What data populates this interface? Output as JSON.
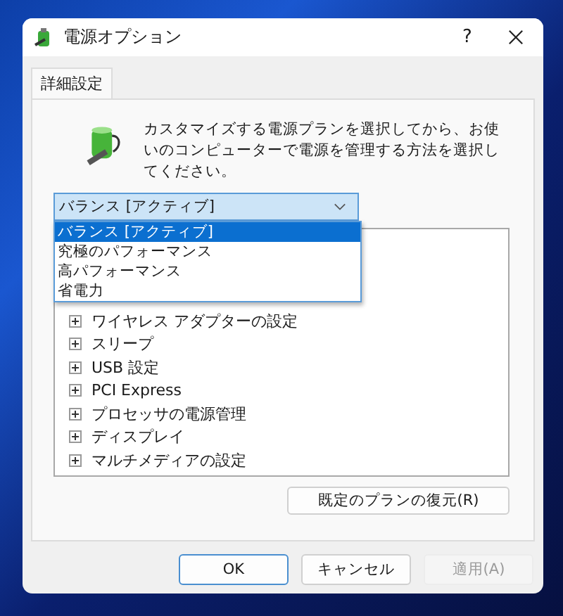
{
  "window": {
    "title": "電源オプション",
    "help": "?"
  },
  "tabs": [
    {
      "label": "詳細設定",
      "selected": true
    }
  ],
  "description": "カスタマイズする電源プランを選択してから、お使いのコンピューターで電源を管理する方法を選択してください。",
  "plan_select": {
    "value": "バランス [アクティブ]",
    "options": [
      {
        "label": "バランス [アクティブ]",
        "selected": true
      },
      {
        "label": "究極のパフォーマンス",
        "selected": false
      },
      {
        "label": "高パフォーマンス",
        "selected": false
      },
      {
        "label": "省電力",
        "selected": false
      }
    ]
  },
  "settings_tree": [
    {
      "label": "ワイヤレス アダプターの設定",
      "expanded": false
    },
    {
      "label": "スリープ",
      "expanded": false
    },
    {
      "label": "USB 設定",
      "expanded": false
    },
    {
      "label": "PCI Express",
      "expanded": false
    },
    {
      "label": "プロセッサの電源管理",
      "expanded": false
    },
    {
      "label": "ディスプレイ",
      "expanded": false
    },
    {
      "label": "マルチメディアの設定",
      "expanded": false
    }
  ],
  "restore_button": "既定のプランの復元(R)",
  "buttons": [
    {
      "label": "OK",
      "kind": "default",
      "disabled": false
    },
    {
      "label": "キャンセル",
      "kind": "normal",
      "disabled": false
    },
    {
      "label": "適用(A)",
      "kind": "normal",
      "disabled": true
    }
  ]
}
